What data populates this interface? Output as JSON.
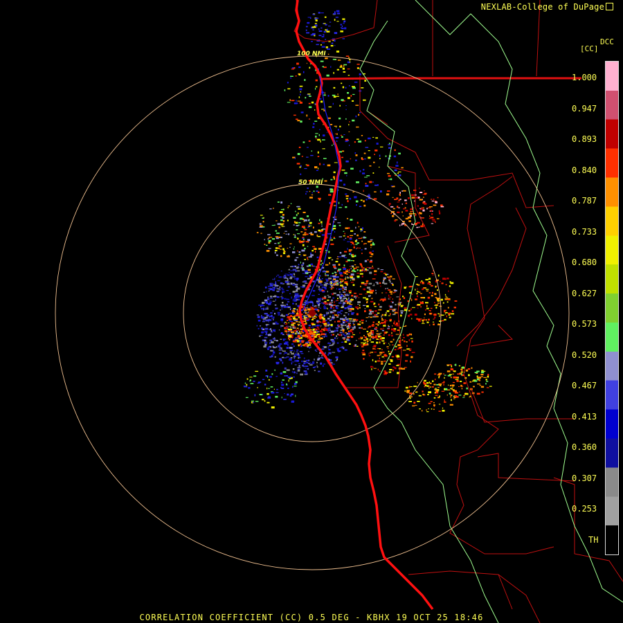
{
  "header": {
    "credit": "NEXLAB-College of DuPage"
  },
  "legend": {
    "product_label": "[CC]",
    "name_label": "DCC",
    "ticks": [
      "1.000",
      "0.947",
      "0.893",
      "0.840",
      "0.787",
      "0.733",
      "0.680",
      "0.627",
      "0.573",
      "0.520",
      "0.467",
      "0.413",
      "0.360",
      "0.307",
      "0.253",
      "TH"
    ],
    "colors": [
      "#ffb0d0",
      "#d05070",
      "#c00000",
      "#ff3000",
      "#ff9000",
      "#ffd000",
      "#f0f000",
      "#c0e000",
      "#80d030",
      "#60f060",
      "#9090d0",
      "#4040e0",
      "#0000d0",
      "#1010a0",
      "#8a8a8a",
      "#a0a0a0",
      "#000000"
    ]
  },
  "rings": [
    {
      "label": "50 NMI"
    },
    {
      "label": "100 NMI"
    }
  ],
  "footer": {
    "title": "CORRELATION COEFFICIENT (CC) 0.5 DEG - KBHX 19 OCT 25 18:46"
  }
}
